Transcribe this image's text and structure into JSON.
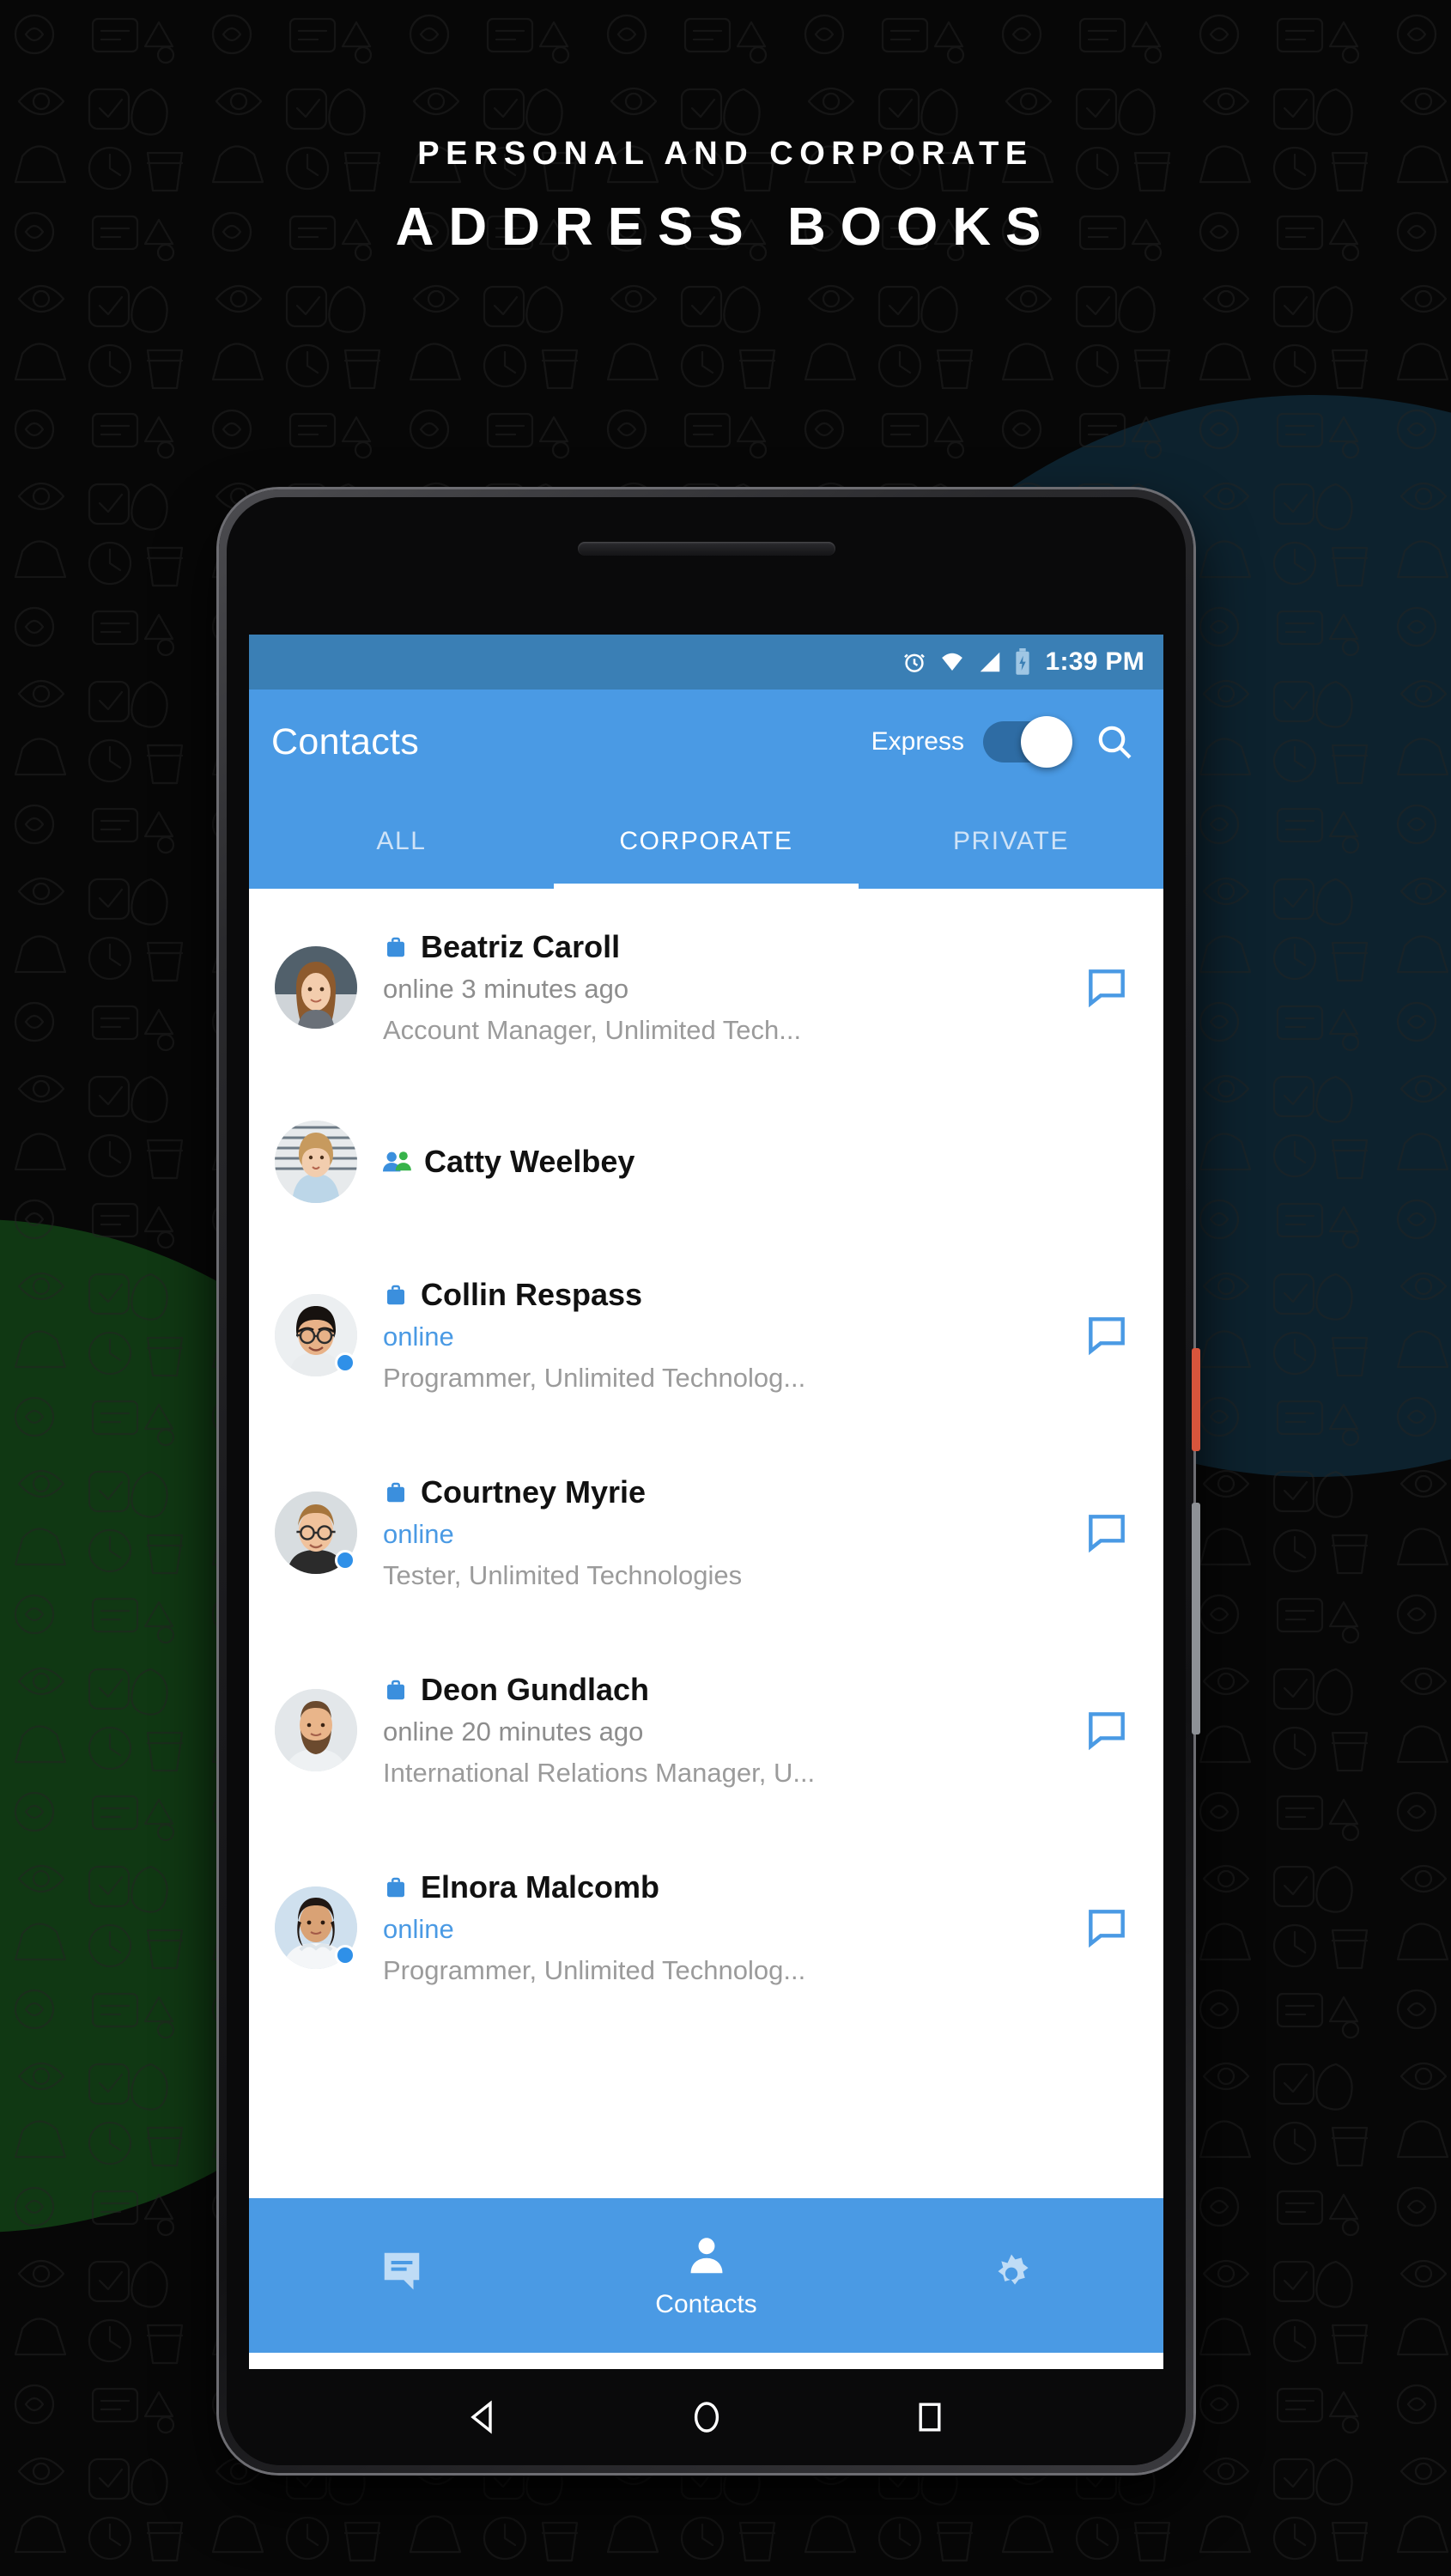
{
  "promo": {
    "line1": "PERSONAL AND CORPORATE",
    "line2": "ADDRESS BOOKS"
  },
  "colors": {
    "accent": "#4a9ae4",
    "statusbar": "#3a7fb5",
    "toggle_track": "#2e6ca4",
    "online_text": "#4a9ae4",
    "secondary_text": "#9b9b9b",
    "green_blob": "#113b14",
    "teal_blob": "#0e2430"
  },
  "statusbar": {
    "time": "1:39 PM",
    "icons": [
      "alarm-icon",
      "wifi-icon",
      "signal-icon",
      "battery-charging-icon"
    ]
  },
  "appbar": {
    "title": "Contacts",
    "express_label": "Express",
    "express_on": true,
    "search_icon": "search-icon"
  },
  "tabs": [
    {
      "label": "ALL",
      "active": false
    },
    {
      "label": "CORPORATE",
      "active": true
    },
    {
      "label": "PRIVATE",
      "active": false
    }
  ],
  "contacts": [
    {
      "name": "Beatriz Caroll",
      "type_icon": "briefcase-icon",
      "status": "online 3 minutes ago",
      "status_online": false,
      "title": "Account Manager, Unlimited Tech...",
      "has_chat": true,
      "online_dot": false
    },
    {
      "name": "Catty Weelbey",
      "type_icon": "group-icon",
      "status": "",
      "status_online": false,
      "title": "",
      "has_chat": false,
      "online_dot": false
    },
    {
      "name": "Collin Respass",
      "type_icon": "briefcase-icon",
      "status": "online",
      "status_online": true,
      "title": "Programmer, Unlimited Technolog...",
      "has_chat": true,
      "online_dot": true
    },
    {
      "name": "Courtney Myrie",
      "type_icon": "briefcase-icon",
      "status": "online",
      "status_online": true,
      "title": "Tester, Unlimited Technologies",
      "has_chat": true,
      "online_dot": true
    },
    {
      "name": "Deon Gundlach",
      "type_icon": "briefcase-icon",
      "status": "online 20 minutes ago",
      "status_online": false,
      "title": "International Relations Manager, U...",
      "has_chat": true,
      "online_dot": false
    },
    {
      "name": "Elnora Malcomb",
      "type_icon": "briefcase-icon",
      "status": "online",
      "status_online": true,
      "title": "Programmer, Unlimited Technolog...",
      "has_chat": true,
      "online_dot": true
    }
  ],
  "bottomnav": [
    {
      "icon": "chat-icon",
      "label": "",
      "active": false
    },
    {
      "icon": "person-icon",
      "label": "Contacts",
      "active": true
    },
    {
      "icon": "gear-icon",
      "label": "",
      "active": false
    }
  ],
  "sysnav": [
    "back-icon",
    "home-icon",
    "recents-icon"
  ]
}
